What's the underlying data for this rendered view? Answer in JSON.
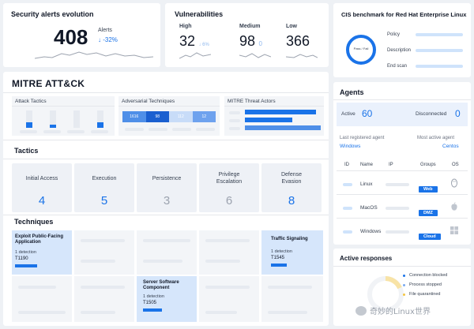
{
  "security_alerts": {
    "title": "Security alerts evolution",
    "value": "408",
    "label": "Alerts",
    "delta": "↓ -32%"
  },
  "vulnerabilities": {
    "title": "Vulnerabilities",
    "items": [
      {
        "label": "High",
        "value": "32",
        "delta": "↓ 6%"
      },
      {
        "label": "Medium",
        "value": "98",
        "delta": "0"
      },
      {
        "label": "Low",
        "value": "366",
        "delta": "0"
      }
    ]
  },
  "cis": {
    "title": "CIS benchmark for Red Hat Enterprise Linux",
    "donut_text": "Pass / Fail",
    "rows": [
      "Policy",
      "Description",
      "End scan"
    ]
  },
  "mitre": {
    "title": "MITRE ATT&CK",
    "panels": [
      {
        "title": "Attack Tactics"
      },
      {
        "title": "Adversarial Techniques",
        "cells": [
          "1616",
          "98",
          "112",
          "12"
        ]
      },
      {
        "title": "MITRE Threat Actors"
      }
    ],
    "tactics_title": "Tactics",
    "tactics": [
      {
        "name": "Initial Access",
        "value": "4"
      },
      {
        "name": "Execution",
        "value": "5"
      },
      {
        "name": "Persistence",
        "value": "3"
      },
      {
        "name": "Privilege Escalation",
        "value": "6"
      },
      {
        "name": "Defense Evasion",
        "value": "8"
      }
    ],
    "techniques_title": "Techniques",
    "techniques": [
      {
        "title": "Exploit Public-Facing Application",
        "detections": "1 detection",
        "id": "T1190"
      },
      {
        "title": "Server Software Component",
        "detections": "1 detection",
        "id": "T1505"
      },
      {
        "title": "Traffic Signaling",
        "detections": "1 detection",
        "id": "T1545"
      }
    ]
  },
  "agents": {
    "title": "Agents",
    "active_label": "Active",
    "active_value": "60",
    "disconnected_label": "Disconnected",
    "disconnected_value": "0",
    "last_registered_label": "Last registered agent",
    "last_registered_value": "Windows",
    "most_active_label": "Most active agent",
    "most_active_value": "Centos",
    "columns": [
      "ID",
      "Name",
      "IP",
      "Groups",
      "OS"
    ],
    "rows": [
      {
        "name": "Linux",
        "group": "Web",
        "os_icon": "linux-icon"
      },
      {
        "name": "MacOS",
        "group": "DMZ",
        "os_icon": "apple-icon"
      },
      {
        "name": "Windows",
        "group": "Cloud",
        "os_icon": "windows-icon"
      }
    ]
  },
  "active_responses": {
    "title": "Active responses",
    "legend": [
      {
        "label": "Connection blocked",
        "color": "#1a73e8"
      },
      {
        "label": "Process stopped",
        "color": "#7aaaf0"
      },
      {
        "label": "File quarantined",
        "color": "#f4c542"
      }
    ]
  },
  "watermark": "奇妙的Linux世界",
  "colors": {
    "accent": "#1a73e8",
    "light_accent": "#8fb8ee",
    "panel": "#eef1f6"
  }
}
